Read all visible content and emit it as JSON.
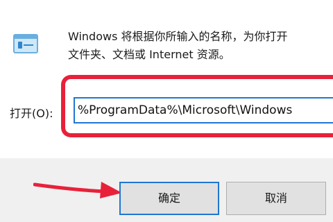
{
  "dialog": {
    "description_line1": "Windows 将根据你所输入的名称，为你打开",
    "description_line2": "文件夹、文档或 Internet 资源。",
    "open_label": "打开(O):",
    "input_value": "%ProgramData%\\Microsoft\\Windows",
    "ok_label": "确定",
    "cancel_label": "取消"
  },
  "icons": {
    "run": "run-dialog-icon",
    "annotation_arrow": "red-arrow-icon"
  },
  "colors": {
    "annotation": "#e8213a",
    "focus_blue": "#1f77d0",
    "button_bg": "#e1e1e1",
    "footer_bg": "#f0f0f0"
  }
}
